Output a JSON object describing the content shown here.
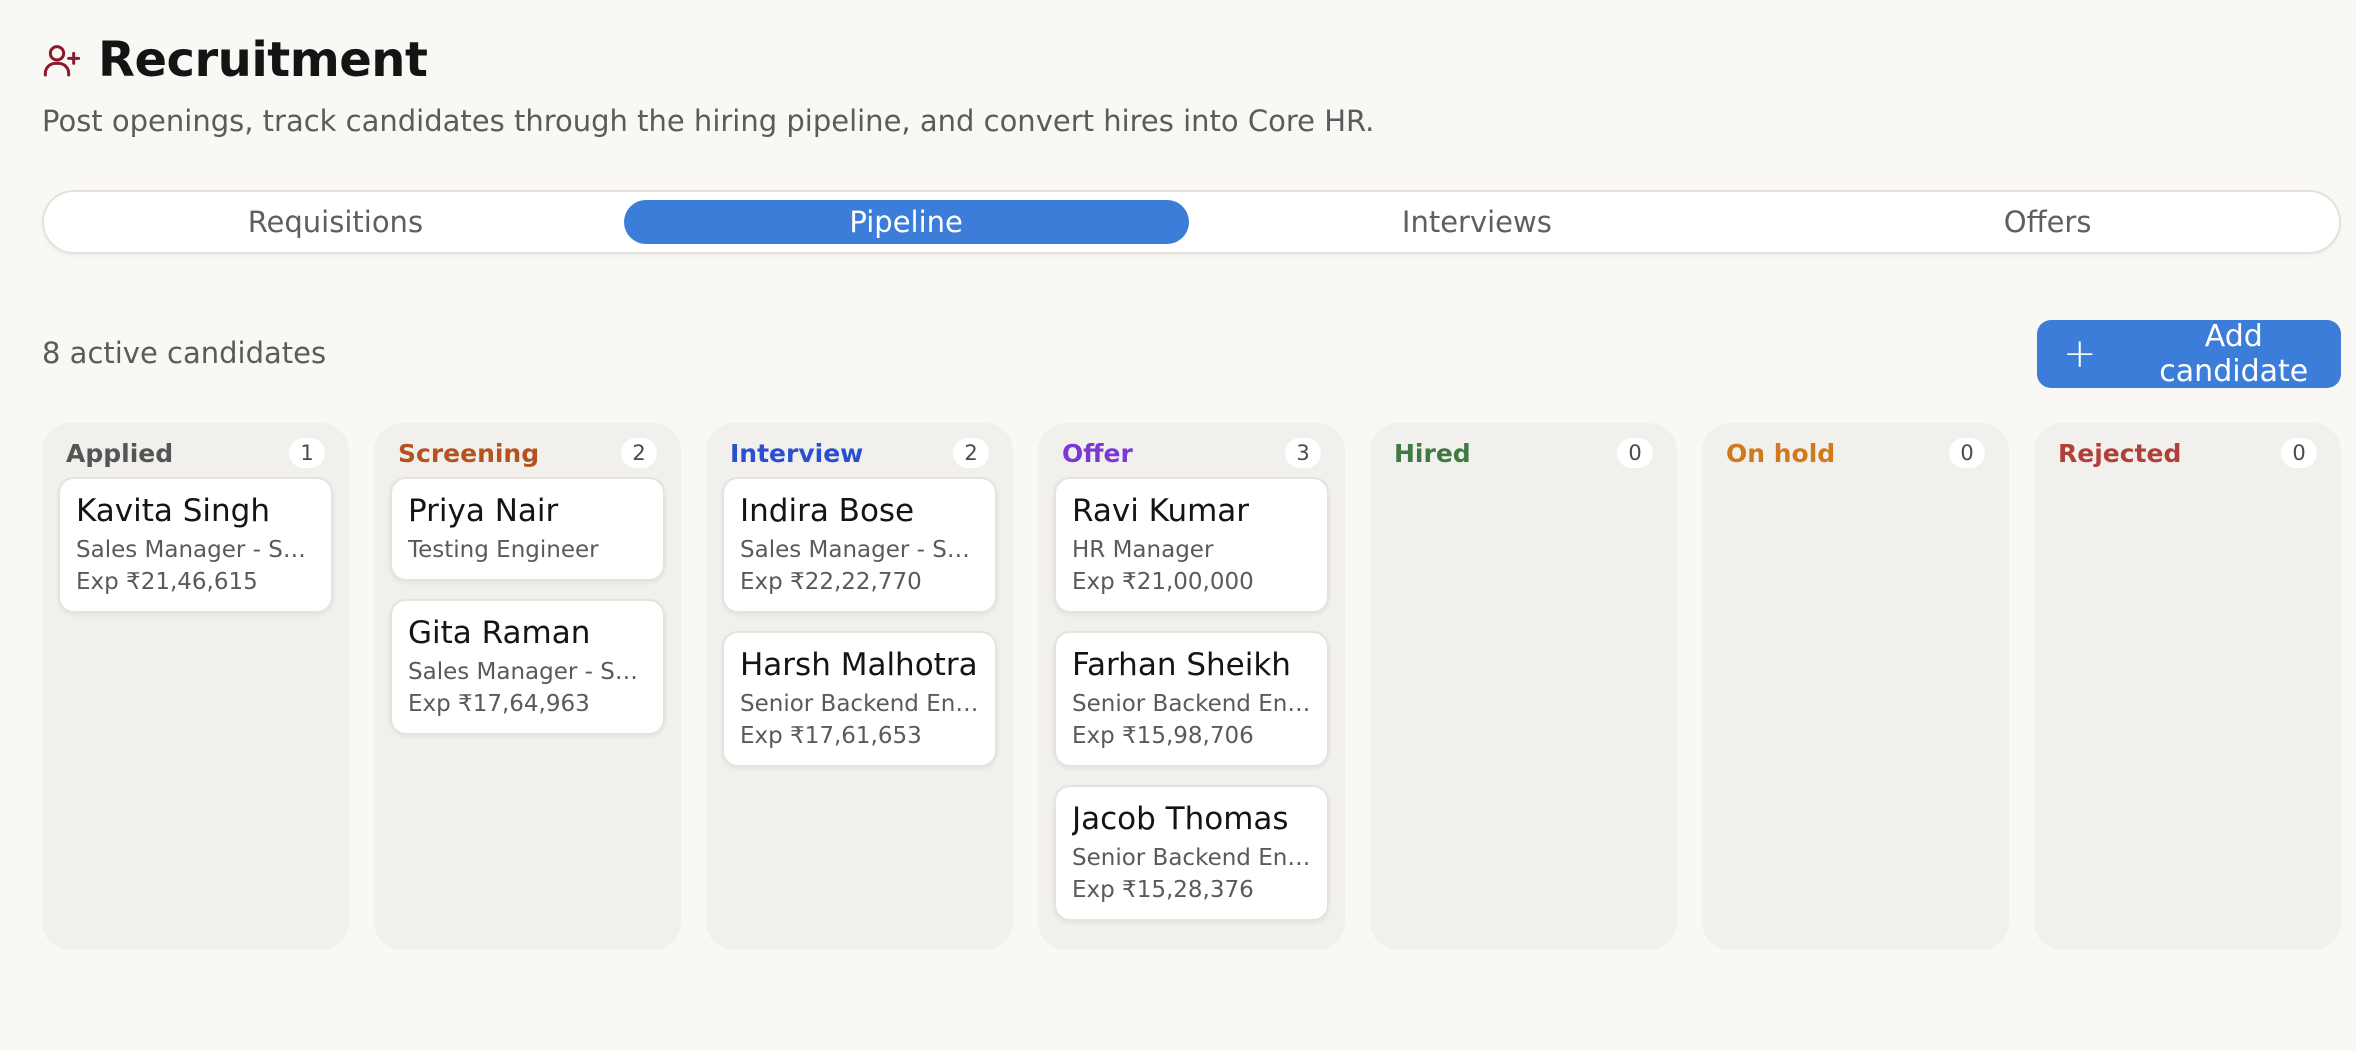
{
  "header": {
    "title": "Recruitment",
    "subtitle": "Post openings, track candidates through the hiring pipeline, and convert hires into Core HR.",
    "icon": "user-plus-icon",
    "icon_color": "#8b1a2b"
  },
  "tabs": [
    {
      "label": "Requisitions",
      "active": false
    },
    {
      "label": "Pipeline",
      "active": true
    },
    {
      "label": "Interviews",
      "active": false
    },
    {
      "label": "Offers",
      "active": false
    }
  ],
  "toolbar": {
    "candidate_count_label": "8 active candidates",
    "add_button_label": "Add candidate",
    "accent_color": "#3b7dd8"
  },
  "columns": [
    {
      "name": "Applied",
      "count": "1",
      "color": "#555555",
      "cards": [
        {
          "name": "Kavita Singh",
          "role": "Sales Manager - So...",
          "exp": "Exp ₹21,46,615"
        }
      ]
    },
    {
      "name": "Screening",
      "count": "2",
      "color": "#b5531f",
      "cards": [
        {
          "name": "Priya Nair",
          "role": "Testing Engineer",
          "exp": ""
        },
        {
          "name": "Gita Raman",
          "role": "Sales Manager - So...",
          "exp": "Exp ₹17,64,963"
        }
      ]
    },
    {
      "name": "Interview",
      "count": "2",
      "color": "#2a4fd0",
      "cards": [
        {
          "name": "Indira Bose",
          "role": "Sales Manager - So...",
          "exp": "Exp ₹22,22,770"
        },
        {
          "name": "Harsh Malhotra",
          "role": "Senior Backend Engi...",
          "exp": "Exp ₹17,61,653"
        }
      ]
    },
    {
      "name": "Offer",
      "count": "3",
      "color": "#7a38d4",
      "cards": [
        {
          "name": "Ravi Kumar",
          "role": "HR Manager",
          "exp": "Exp ₹21,00,000"
        },
        {
          "name": "Farhan Sheikh",
          "role": "Senior Backend Engi...",
          "exp": "Exp ₹15,98,706"
        },
        {
          "name": "Jacob Thomas",
          "role": "Senior Backend Engi...",
          "exp": "Exp ₹15,28,376"
        }
      ]
    },
    {
      "name": "Hired",
      "count": "0",
      "color": "#3f7a42",
      "cards": []
    },
    {
      "name": "On hold",
      "count": "0",
      "color": "#d07a1e",
      "cards": []
    },
    {
      "name": "Rejected",
      "count": "0",
      "color": "#b0403a",
      "cards": []
    }
  ]
}
